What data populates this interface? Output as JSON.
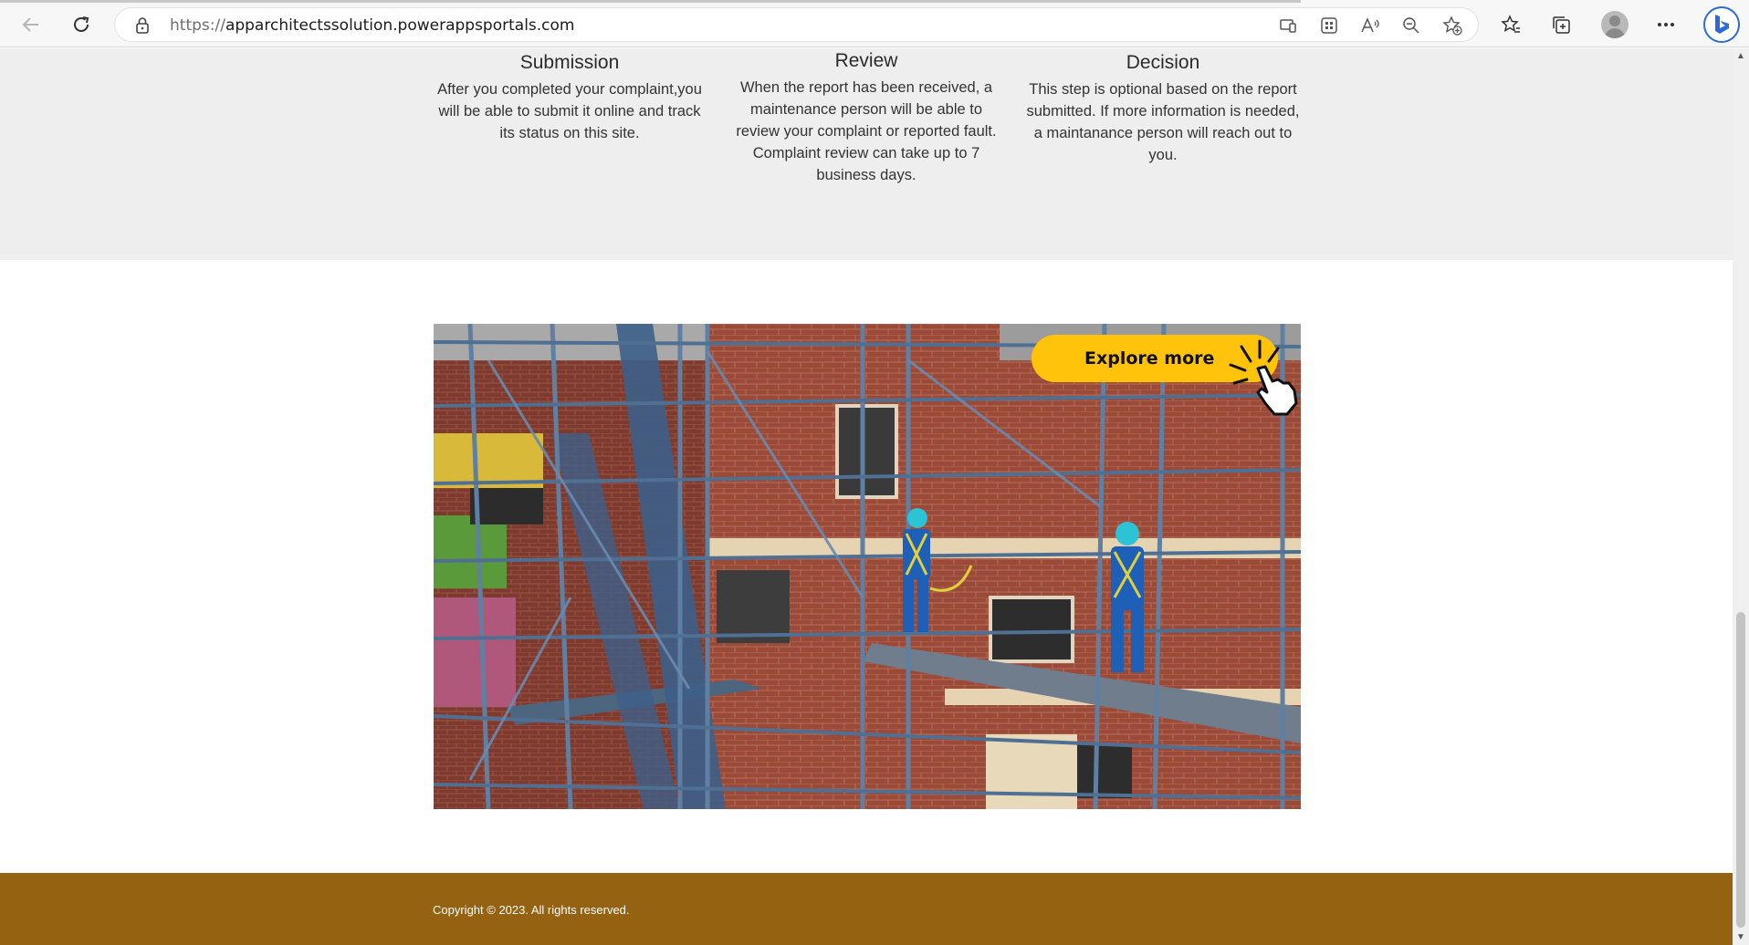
{
  "browser": {
    "url_scheme": "https://",
    "url_host": "apparchitectssolution.powerappsportals.com",
    "icons": [
      "back-arrow-icon",
      "refresh-icon",
      "lock-icon",
      "app-available-icon",
      "apps-icon",
      "read-aloud-icon",
      "zoom-out-icon",
      "add-favorite-icon",
      "favorites-icon",
      "collections-icon",
      "profile-icon",
      "more-icon",
      "bing-icon"
    ]
  },
  "steps": [
    {
      "title": "Submission",
      "text": "After you completed your complaint,you will be able to submit it online and track its status on this site."
    },
    {
      "title": "Review",
      "text": "When the report has been received, a maintenance person will be able to review your complaint or reported fault. Complaint review can take up to 7 business days."
    },
    {
      "title": "Decision",
      "text": "This step is optional based on the report submitted. If more information is needed, a maintanance person will reach out to you."
    }
  ],
  "hero": {
    "cta_label": "Explore more",
    "cta_color": "#ffc30b"
  },
  "footer": {
    "copyright": "Copyright © 2023. All rights reserved.",
    "background": "#956212"
  }
}
